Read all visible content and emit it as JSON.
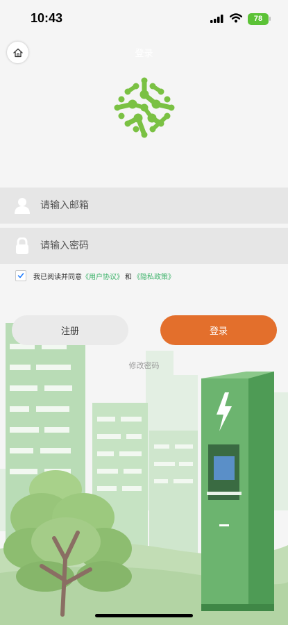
{
  "status_bar": {
    "time": "10:43",
    "battery": "78"
  },
  "header": {
    "title": "登录"
  },
  "form": {
    "email_placeholder": "请输入邮箱",
    "password_placeholder": "请输入密码"
  },
  "agreement": {
    "checked": true,
    "prefix": "我已阅读并同意",
    "user_agreement": "《用户协议》",
    "connector": "和",
    "privacy_policy": "《隐私政策》"
  },
  "actions": {
    "register": "注册",
    "login": "登录",
    "change_password": "修改密码"
  },
  "colors": {
    "accent_orange": "#e36f2c",
    "logo_green": "#7ac143",
    "link_green": "#3db36a",
    "battery_green": "#5bc236"
  },
  "icons": [
    "home-icon",
    "user-icon",
    "lock-icon",
    "checkmark-icon",
    "lightning-icon",
    "wifi-icon",
    "signal-icon"
  ]
}
